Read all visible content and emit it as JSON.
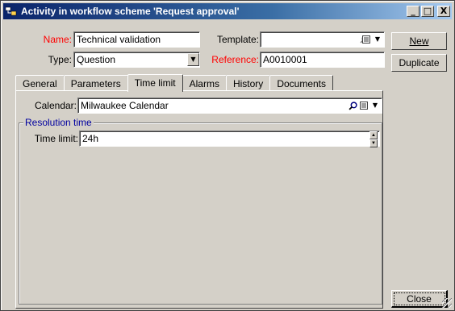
{
  "window": {
    "title": "Activity in workflow scheme 'Request approval'",
    "controls": {
      "minimize": "_",
      "maximize": "□",
      "close": "X"
    }
  },
  "form": {
    "name_label": "Name:",
    "name_value": "Technical validation",
    "template_label": "Template:",
    "template_value": "",
    "type_label": "Type:",
    "type_value": "Question",
    "reference_label": "Reference:",
    "reference_value": "A0010001"
  },
  "buttons": {
    "new": "New",
    "duplicate": "Duplicate",
    "close": "Close"
  },
  "tabs": [
    {
      "label": "General"
    },
    {
      "label": "Parameters"
    },
    {
      "label": "Time limit",
      "active": true
    },
    {
      "label": "Alarms"
    },
    {
      "label": "History"
    },
    {
      "label": "Documents"
    }
  ],
  "time_limit_tab": {
    "calendar_label": "Calendar:",
    "calendar_value": "Milwaukee Calendar",
    "group_title": "Resolution time",
    "time_limit_label": "Time limit:",
    "time_limit_value": "24h"
  },
  "icons": {
    "title": "workflow-activity-icon",
    "zoom": "magnifier-icon",
    "detail": "detail-window-icon",
    "dropdown": "chevron-down-icon",
    "spinner": "spinner-arrows-icon"
  },
  "colors": {
    "title_start": "#0a246a",
    "title_end": "#a6caf0",
    "mandatory_label": "#ff0000",
    "group_title": "#0000a0",
    "face": "#d4d0c8"
  }
}
